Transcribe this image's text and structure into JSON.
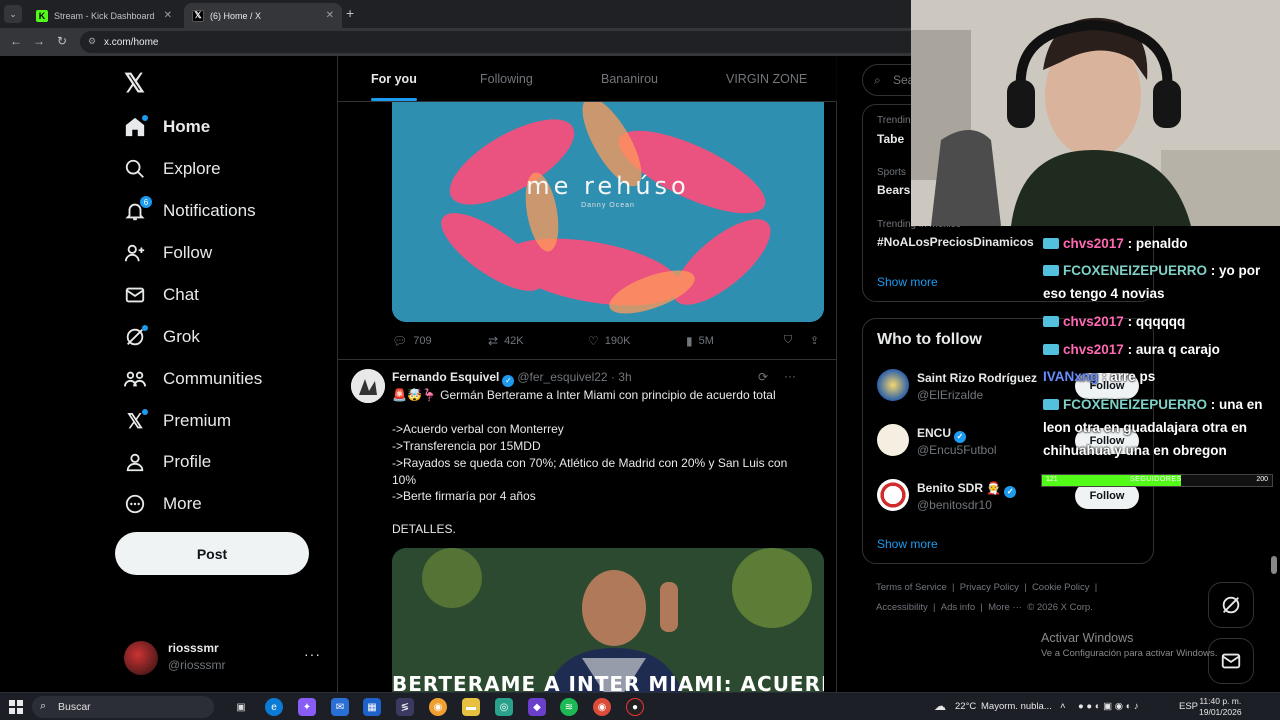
{
  "browser": {
    "tabs": [
      {
        "title": "Stream - Kick Dashboard",
        "favicon": "kick-icon",
        "color": "#53fc18"
      },
      {
        "title": "(6) Home / X",
        "favicon": "x-icon",
        "color": "#000000"
      }
    ],
    "url": "x.com/home"
  },
  "nav": {
    "items": [
      {
        "label": "Home",
        "icon": "home-icon"
      },
      {
        "label": "Explore",
        "icon": "search-icon"
      },
      {
        "label": "Notifications",
        "icon": "bell-icon",
        "badge": "6"
      },
      {
        "label": "Follow",
        "icon": "person-add-icon"
      },
      {
        "label": "Chat",
        "icon": "mail-icon"
      },
      {
        "label": "Grok",
        "icon": "grok-icon"
      },
      {
        "label": "Communities",
        "icon": "communities-icon"
      },
      {
        "label": "Premium",
        "icon": "x-icon"
      },
      {
        "label": "Profile",
        "icon": "person-icon"
      },
      {
        "label": "More",
        "icon": "more-circle-icon"
      }
    ],
    "post_label": "Post",
    "account": {
      "name": "riosssmr",
      "handle": "@riosssmr"
    }
  },
  "feed": {
    "tabs": [
      "For you",
      "Following",
      "Bananirou",
      "VIRGIN ZONE"
    ],
    "media1": {
      "title": "me rehúso",
      "subtitle": "Danny Ocean"
    },
    "stats1": {
      "replies": "709",
      "reposts": "42K",
      "likes": "190K",
      "views": "5M"
    },
    "tweet": {
      "name": "Fernando Esquivel",
      "handle": "@fer_esquivel22",
      "time": "· 3h",
      "lines": [
        "🚨🤯🦩 Germán Berterame a Inter Miami con principio de acuerdo total",
        "->Acuerdo verbal con Monterrey",
        "->Transferencia por 15MDD",
        "->Rayados se queda con  70%; Atlético de Madrid con 20% y San Luis con",
        "10%",
        "->Berte firmaría por 4 años",
        "DETALLES."
      ],
      "image_caption": "BERTERAME A INTER MIAMI: ACUERDO"
    }
  },
  "right": {
    "search_placeholder": "Sea",
    "trends": [
      {
        "meta": "Trendin",
        "name": "Tabe"
      },
      {
        "meta": "Sports",
        "name": "Bears"
      },
      {
        "meta": "Trending in México",
        "name": "#NoALosPreciosDinamicos"
      }
    ],
    "show_more": "Show more",
    "who_to_follow": "Who to follow",
    "suggestions": [
      {
        "name": "Saint Rizo Rodríguez",
        "handle": "@ElErizalde"
      },
      {
        "name": "ENCU",
        "handle": "@Encu5Futbol"
      },
      {
        "name": "Benito SDR 🧑‍🎄",
        "handle": "@benitosdr10"
      }
    ],
    "follow_label": "Follow",
    "show_more2": "Show more",
    "footer": [
      "Terms of Service",
      "|",
      "Privacy Policy",
      "|",
      "Cookie Policy",
      "|"
    ],
    "footer2": [
      "Accessibility",
      "|",
      "Ads info",
      "|",
      "More ···",
      "© 2026 X Corp."
    ]
  },
  "chat": {
    "messages": [
      {
        "user": "chvs2017",
        "text": ": penaldo",
        "color": "u1"
      },
      {
        "user": "FCOXENEIZEPUERRO",
        "text": ": yo por eso tengo 4 novias",
        "color": "u2"
      },
      {
        "user": "chvs2017",
        "text": ": qqqqqq",
        "color": "u1"
      },
      {
        "user": "chvs2017",
        "text": ": aura q carajo",
        "color": "u1"
      },
      {
        "user": "IVANxng",
        "text": ": arre ps",
        "color": "u3"
      },
      {
        "user": "FCOXENEIZEPUERRO",
        "text": ": una en leon otra en guadalajara otra en chihuahua y una en obregon",
        "color": "u2"
      }
    ],
    "follower_goal": {
      "current": "121",
      "label": "SEGUIDORES",
      "target": "200",
      "fraction": 0.605
    }
  },
  "windows": {
    "activate_title": "Activar Windows",
    "activate_sub": "Ve a Configuración para activar Windows.",
    "search_label": "Buscar",
    "weather": "22°C",
    "weather_text": "Mayorm. nubla...",
    "lang": "ESP",
    "time": "11:40 p. m.",
    "date": "19/01/2026"
  }
}
